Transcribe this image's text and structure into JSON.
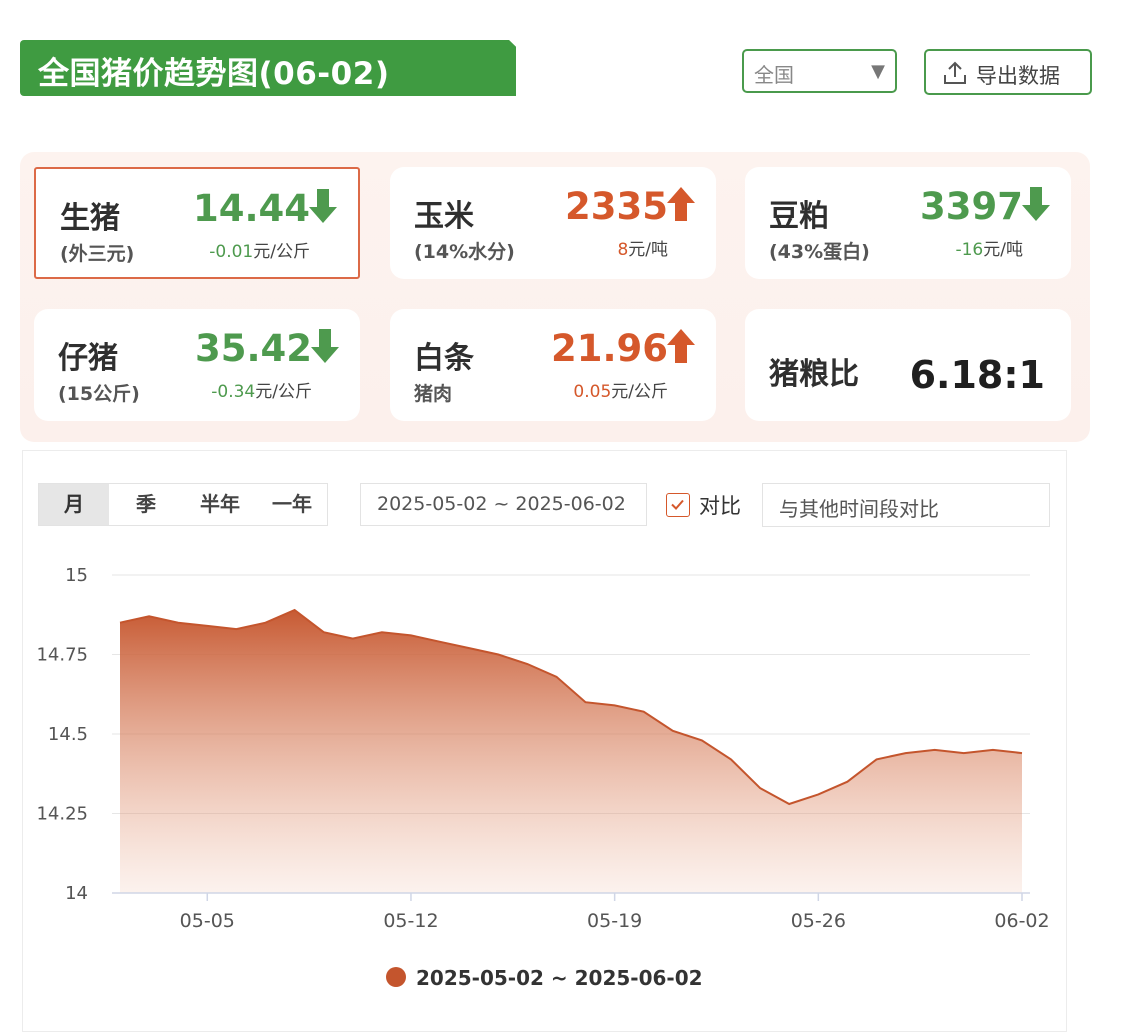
{
  "header": {
    "title": "全国猪价趋势图(06-02)"
  },
  "region": {
    "selected": "全国"
  },
  "export": {
    "label": "导出数据"
  },
  "cards": [
    {
      "name": "生猪",
      "sub": "(外三元)",
      "price": "14.44",
      "trend": "down",
      "chg": "-0.01",
      "unit": "元/公斤"
    },
    {
      "name": "玉米",
      "sub": "(14%水分)",
      "price": "2335",
      "trend": "up",
      "chg": "8",
      "unit": "元/吨"
    },
    {
      "name": "豆粕",
      "sub": "(43%蛋白)",
      "price": "3397",
      "trend": "down",
      "chg": "-16",
      "unit": "元/吨"
    },
    {
      "name": "仔猪",
      "sub": "(15公斤)",
      "price": "35.42",
      "trend": "down",
      "chg": "-0.34",
      "unit": "元/公斤"
    },
    {
      "name": "白条",
      "sub": "猪肉",
      "price": "21.96",
      "trend": "up",
      "chg": "0.05",
      "unit": "元/公斤"
    },
    {
      "name": "猪粮比",
      "ratio": "6.18:1"
    }
  ],
  "controls": {
    "tabs": [
      "月",
      "季",
      "半年",
      "一年"
    ],
    "active_tab": "月",
    "date_range": "2025-05-02 ~ 2025-06-02",
    "compare_label": "对比",
    "compare_checked": true,
    "compare_placeholder": "与其他时间段对比"
  },
  "colors": {
    "green": "#4e9a4e",
    "red": "#d5582b",
    "accent": "#3f9b41"
  },
  "chart_data": {
    "type": "area",
    "x": [
      "2025-05-02",
      "2025-05-03",
      "2025-05-04",
      "2025-05-05",
      "2025-05-06",
      "2025-05-07",
      "2025-05-08",
      "2025-05-09",
      "2025-05-10",
      "2025-05-11",
      "2025-05-12",
      "2025-05-13",
      "2025-05-14",
      "2025-05-15",
      "2025-05-16",
      "2025-05-17",
      "2025-05-18",
      "2025-05-19",
      "2025-05-20",
      "2025-05-21",
      "2025-05-22",
      "2025-05-23",
      "2025-05-24",
      "2025-05-25",
      "2025-05-26",
      "2025-05-27",
      "2025-05-28",
      "2025-05-29",
      "2025-05-30",
      "2025-05-31",
      "2025-06-01",
      "2025-06-02"
    ],
    "series": [
      {
        "name": "2025-05-02 ~ 2025-06-02",
        "values": [
          14.85,
          14.87,
          14.85,
          14.84,
          14.83,
          14.85,
          14.89,
          14.82,
          14.8,
          14.82,
          14.81,
          14.79,
          14.77,
          14.75,
          14.72,
          14.68,
          14.6,
          14.59,
          14.57,
          14.51,
          14.48,
          14.42,
          14.33,
          14.28,
          14.31,
          14.35,
          14.42,
          14.44,
          14.45,
          14.44,
          14.45,
          14.44
        ]
      }
    ],
    "yticks": [
      14,
      14.25,
      14.5,
      14.75,
      15
    ],
    "ytick_labels": [
      "14",
      "14.25",
      "14.5",
      "14.75",
      "15"
    ],
    "ylim": [
      14,
      15
    ],
    "xticks": [
      "05-05",
      "05-12",
      "05-19",
      "05-26",
      "06-02"
    ],
    "grid": true,
    "legend": "bottom-center"
  }
}
